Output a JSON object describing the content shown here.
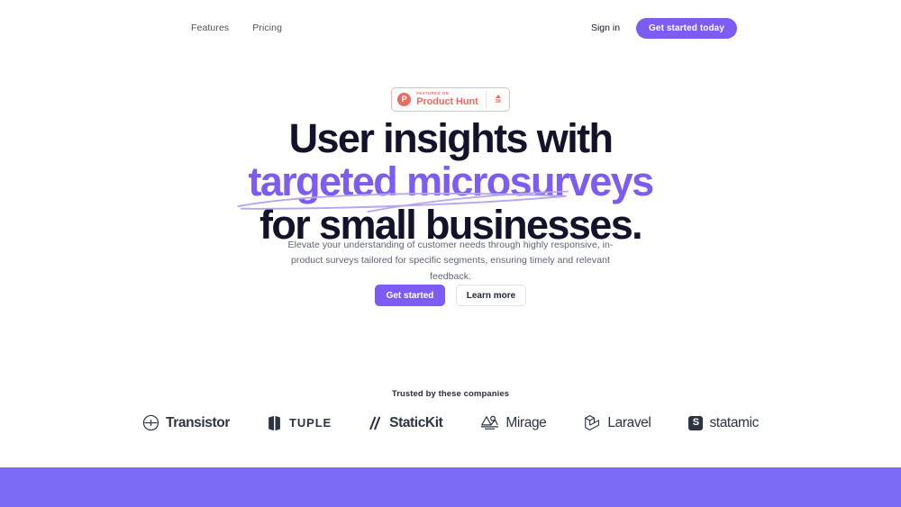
{
  "header": {
    "nav": [
      {
        "label": "Features"
      },
      {
        "label": "Pricing"
      }
    ],
    "signin_label": "Sign in",
    "cta_label": "Get started today"
  },
  "badge": {
    "logo_letter": "P",
    "eyebrow": "FEATURED ON",
    "name": "Product Hunt",
    "vote_count": "38"
  },
  "hero": {
    "title_line1": "User insights with",
    "title_line2_highlight": "targeted microsurveys",
    "title_line3": "for small businesses.",
    "subtitle": "Elevate your understanding of customer needs through highly responsive, in-product surveys tailored for specific segments, ensuring timely and relevant feedback.",
    "primary_cta": "Get started",
    "secondary_cta": "Learn more"
  },
  "trusted": {
    "label": "Trusted by these companies",
    "companies": [
      {
        "name": "Transistor",
        "icon": "transistor-logo-icon"
      },
      {
        "name": "TUPLE",
        "icon": "tuple-logo-icon"
      },
      {
        "name": "StaticKit",
        "icon": "statickit-logo-icon"
      },
      {
        "name": "Mirage",
        "icon": "mirage-logo-icon"
      },
      {
        "name": "Laravel",
        "icon": "laravel-logo-icon"
      },
      {
        "name": "statamic",
        "icon": "statamic-logo-icon"
      }
    ]
  },
  "colors": {
    "accent_purple": "#7c5cf2",
    "band_purple": "#7c6cf5",
    "product_hunt_red": "#ec6a5e",
    "heading_dark": "#12122b",
    "logo_dark": "#2c3443"
  }
}
